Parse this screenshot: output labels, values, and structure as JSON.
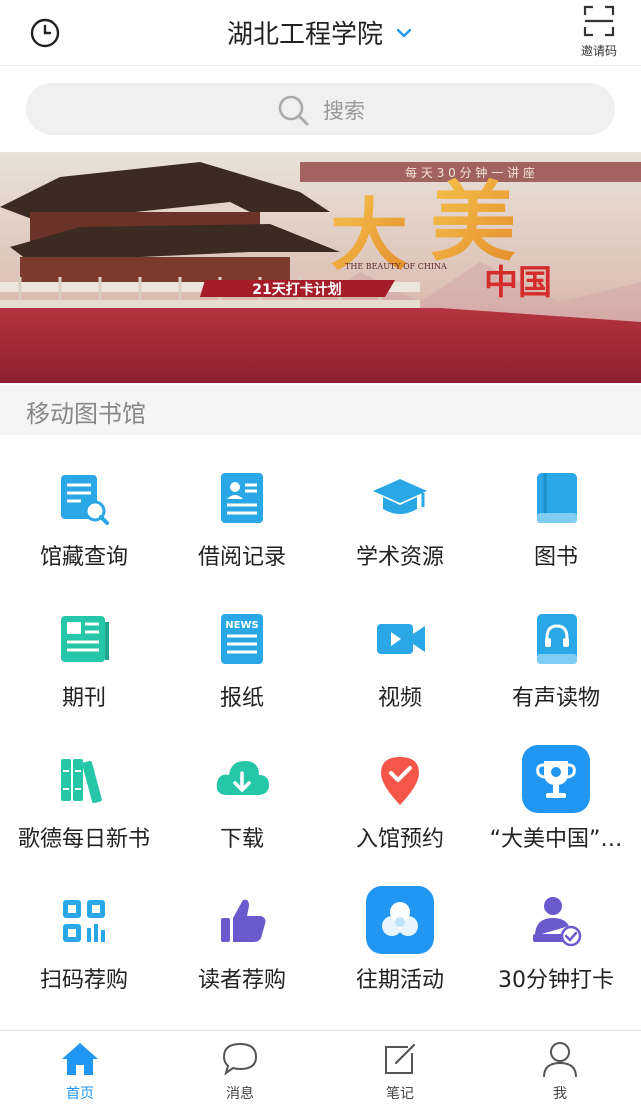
{
  "header": {
    "title": "湖北工程学院",
    "invite_label": "邀请码"
  },
  "search": {
    "placeholder": "搜索"
  },
  "banner": {
    "top_line": "每 天 3 0 分 钟 一 讲 座",
    "big_title_1": "大",
    "big_title_2": "美",
    "sub_title": "中国",
    "english": "THE BEAUTY OF CHINA",
    "ribbon": "21天打卡计划"
  },
  "section": {
    "title": "移动图书馆"
  },
  "grid": [
    {
      "label": "馆藏查询",
      "icon": "catalog-search-icon"
    },
    {
      "label": "借阅记录",
      "icon": "borrow-record-icon"
    },
    {
      "label": "学术资源",
      "icon": "graduation-cap-icon"
    },
    {
      "label": "图书",
      "icon": "book-icon"
    },
    {
      "label": "期刊",
      "icon": "journal-icon"
    },
    {
      "label": "报纸",
      "icon": "newspaper-icon"
    },
    {
      "label": "视频",
      "icon": "video-camera-icon"
    },
    {
      "label": "有声读物",
      "icon": "audiobook-icon"
    },
    {
      "label": "歌德每日新书",
      "icon": "bookshelf-icon"
    },
    {
      "label": "下载",
      "icon": "cloud-download-icon"
    },
    {
      "label": "入馆预约",
      "icon": "location-check-icon"
    },
    {
      "label": "“大美中国”…",
      "icon": "trophy-app-icon"
    },
    {
      "label": "扫码荐购",
      "icon": "qr-code-icon"
    },
    {
      "label": "读者荐购",
      "icon": "thumbs-up-icon"
    },
    {
      "label": "往期活动",
      "icon": "circles-app-icon"
    },
    {
      "label": "30分钟打卡",
      "icon": "user-check-icon"
    }
  ],
  "tabs": [
    {
      "label": "首页",
      "icon": "home-icon",
      "active": true
    },
    {
      "label": "消息",
      "icon": "chat-bubble-icon",
      "active": false
    },
    {
      "label": "笔记",
      "icon": "edit-note-icon",
      "active": false
    },
    {
      "label": "我",
      "icon": "person-icon",
      "active": false
    }
  ],
  "colors": {
    "accent": "#2196f3",
    "cyan": "#29a7e6",
    "teal": "#26c6a8",
    "purple": "#6a5acd",
    "red": "#f4574a"
  }
}
